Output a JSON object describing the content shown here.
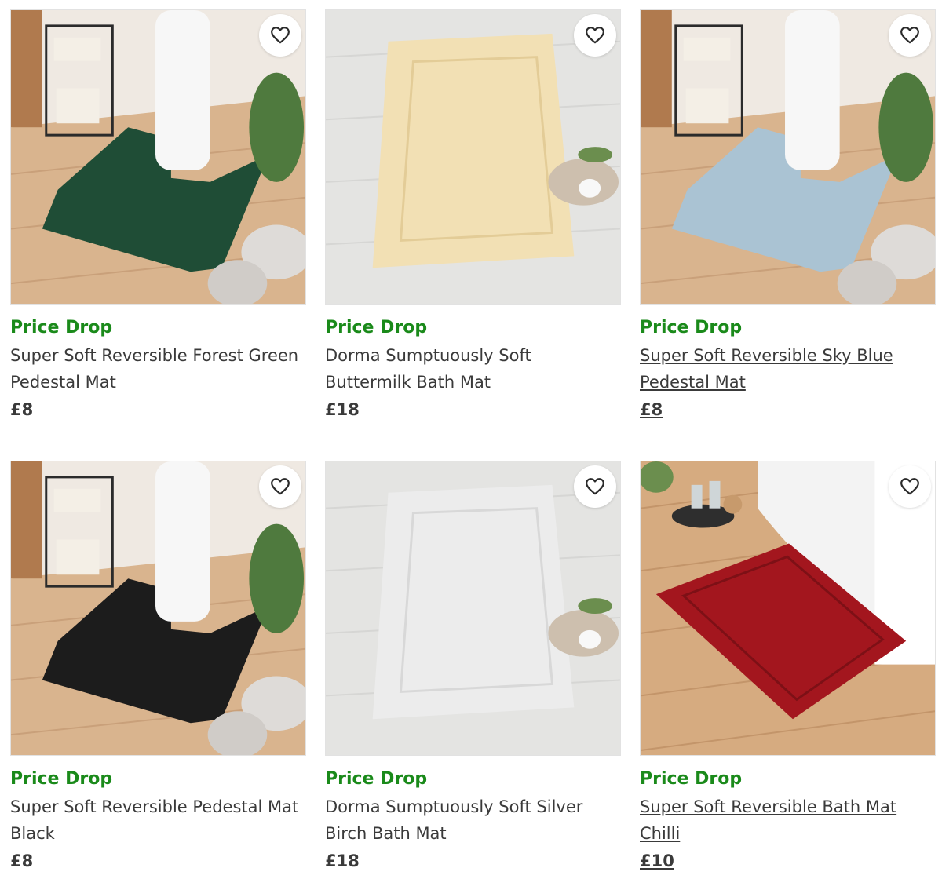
{
  "products": [
    {
      "badge": "Price Drop",
      "name": "Super Soft Reversible Forest Green Pedestal Mat",
      "price": "£8",
      "mat_color": "#1f4d36",
      "scene": "pedestal",
      "underlined": false
    },
    {
      "badge": "Price Drop",
      "name": "Dorma Sumptuously Soft Buttermilk Bath Mat",
      "price": "£18",
      "mat_color": "#f2e0b4",
      "scene": "bathmat-grey-floor",
      "underlined": false
    },
    {
      "badge": "Price Drop",
      "name": "Super Soft Reversible Sky Blue Pedestal Mat",
      "price": "£8",
      "mat_color": "#aac3d3",
      "scene": "pedestal",
      "underlined": true
    },
    {
      "badge": "Price Drop",
      "name": "Super Soft Reversible Pedestal Mat Black",
      "price": "£8",
      "mat_color": "#1c1c1c",
      "scene": "pedestal",
      "underlined": false
    },
    {
      "badge": "Price Drop",
      "name": "Dorma Sumptuously Soft Silver Birch Bath Mat",
      "price": "£18",
      "mat_color": "#ececec",
      "scene": "bathmat-grey-floor",
      "underlined": false
    },
    {
      "badge": "Price Drop",
      "name": "Super Soft Reversible Bath Mat Chilli",
      "price": "£10",
      "mat_color": "#a3161e",
      "scene": "bathmat-wood-floor",
      "underlined": true
    }
  ],
  "colors": {
    "badge_green": "#1a8a1a",
    "text": "#3a3a3a"
  },
  "icons": {
    "wishlist": "heart-outline-icon"
  }
}
